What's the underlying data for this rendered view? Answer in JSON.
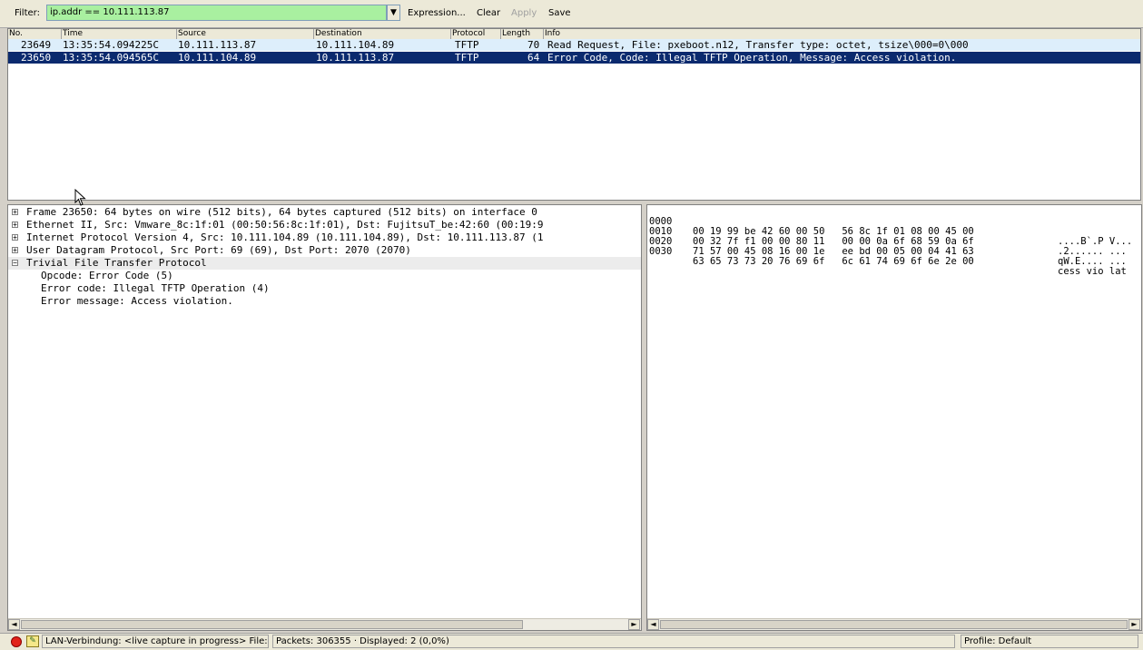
{
  "toolbar": {
    "filter_label": "Filter:",
    "filter_value": "ip.addr == 10.111.113.87",
    "dropdown_icon": "chevron-down",
    "expression_label": "Expression...",
    "clear_label": "Clear",
    "apply_label": "Apply",
    "save_label": "Save"
  },
  "packet_list": {
    "columns": [
      "No.",
      "Time",
      "Source",
      "Destination",
      "Protocol",
      "Length",
      "Info"
    ],
    "rows": [
      {
        "no": "23649",
        "time": "13:35:54.094225C",
        "source": "10.111.113.87",
        "destination": "10.111.104.89",
        "protocol": "TFTP",
        "length": "70",
        "info": "Read Request, File: pxeboot.n12, Transfer type: octet, tsize\\000=0\\000"
      },
      {
        "no": "23650",
        "time": "13:35:54.094565C",
        "source": "10.111.104.89",
        "destination": "10.111.113.87",
        "protocol": "TFTP",
        "length": "64",
        "info": "Error Code, Code: Illegal TFTP Operation, Message: Access violation."
      }
    ]
  },
  "details": {
    "items": [
      {
        "expander": "⊞",
        "text": "Frame 23650: 64 bytes on wire (512 bits), 64 bytes captured (512 bits) on interface 0"
      },
      {
        "expander": "⊞",
        "text": "Ethernet II, Src: Vmware_8c:1f:01 (00:50:56:8c:1f:01), Dst: FujitsuT_be:42:60 (00:19:9"
      },
      {
        "expander": "⊞",
        "text": "Internet Protocol Version 4, Src: 10.111.104.89 (10.111.104.89), Dst: 10.111.113.87 (1"
      },
      {
        "expander": "⊞",
        "text": "User Datagram Protocol, Src Port: 69 (69), Dst Port: 2070 (2070)"
      },
      {
        "expander": "⊟",
        "text": "Trivial File Transfer Protocol"
      }
    ],
    "subitems": [
      "Opcode: Error Code (5)",
      "Error code: Illegal TFTP Operation (4)",
      "Error message: Access violation."
    ]
  },
  "bytes": {
    "rows": [
      {
        "offset": "0000",
        "hex": "00 19 99 be 42 60 00 50   56 8c 1f 01 08 00 45 00",
        "ascii": "....B`.P V..."
      },
      {
        "offset": "0010",
        "hex": "00 32 7f f1 00 00 80 11   00 00 0a 6f 68 59 0a 6f",
        "ascii": ".2...... ..."
      },
      {
        "offset": "0020",
        "hex": "71 57 00 45 08 16 00 1e   ee bd 00 05 00 04 41 63",
        "ascii": "qW.E.... ..."
      },
      {
        "offset": "0030",
        "hex": "63 65 73 73 20 76 69 6f   6c 61 74 69 6f 6e 2e 00",
        "ascii": "cess vio lat"
      }
    ]
  },
  "statusbar": {
    "capture": "LAN-Verbindung: <live capture in progress> File:...",
    "packets": "Packets: 306355 · Displayed: 2 (0,0%)",
    "profile": "Profile: Default"
  },
  "colors": {
    "filter_valid": "#a9f0a0",
    "selected_row": "#0b2a6e",
    "udp_row": "#ddeefb"
  }
}
